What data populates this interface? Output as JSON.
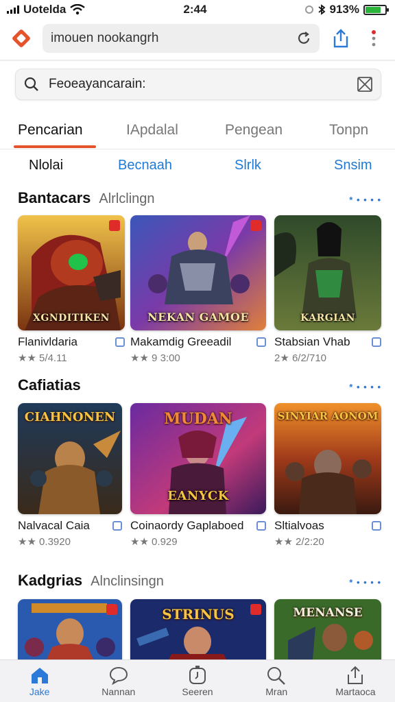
{
  "status_bar": {
    "carrier": "Uotelda",
    "time": "2:44",
    "battery": "913%",
    "battery_level": 0.8
  },
  "browser": {
    "url": "imouen nookangrh"
  },
  "search": {
    "text": "Feoeayancarain:"
  },
  "tabs": [
    "Pencarian",
    "IApdalal",
    "Pengean",
    "Tonpn"
  ],
  "subtabs": [
    "Nlolai",
    "Becnaah",
    "Slrlk",
    "Snsim"
  ],
  "sections": [
    {
      "title": "Bantacars",
      "subtitle": "Alrlclingn",
      "more": "* • • • •",
      "cards": [
        {
          "name": "Flanivldaria",
          "rating": "★★ 5/4.11",
          "image_label": "XGNDITIKEN",
          "image_title": ""
        },
        {
          "name": "Makamdig Greeadil",
          "rating": "★★ 9 3:00",
          "image_label": "NEKAN GAMOE",
          "image_title": ""
        },
        {
          "name": "Stabsian Vhab",
          "rating": "2★ 6/2/710",
          "image_label": "KARGIAN",
          "image_title": ""
        }
      ]
    },
    {
      "title": "Cafiatias",
      "subtitle": "",
      "more": "* • • • •",
      "cards": [
        {
          "name": "Nalvacal Caia",
          "rating": "★★ 0.3920",
          "image_label": "",
          "image_title": "CIAHNONEN"
        },
        {
          "name": "Coinaordy Gaplaboed",
          "rating": "★★ 0.929",
          "image_label": "EANYCK",
          "image_title": "MUDAN"
        },
        {
          "name": "Sltialvoas",
          "rating": "★★ 2/2:20",
          "image_label": "",
          "image_title": "SINYIAR AONOM"
        }
      ]
    },
    {
      "title": "Kadgrias",
      "subtitle": "Alnclinsingn",
      "more": "* • • • •",
      "cards": [
        {
          "name": "",
          "rating": "",
          "image_label": "",
          "image_title": ""
        },
        {
          "name": "",
          "rating": "",
          "image_label": "",
          "image_title": "STRINUS"
        },
        {
          "name": "",
          "rating": "",
          "image_label": "",
          "image_title": "MENANSE"
        }
      ]
    }
  ],
  "bottom_nav": [
    "Jake",
    "Nannan",
    "Seeren",
    "Mran",
    "Martaoca"
  ],
  "colors": {
    "accent": "#e4532c",
    "link": "#2b79d9"
  }
}
